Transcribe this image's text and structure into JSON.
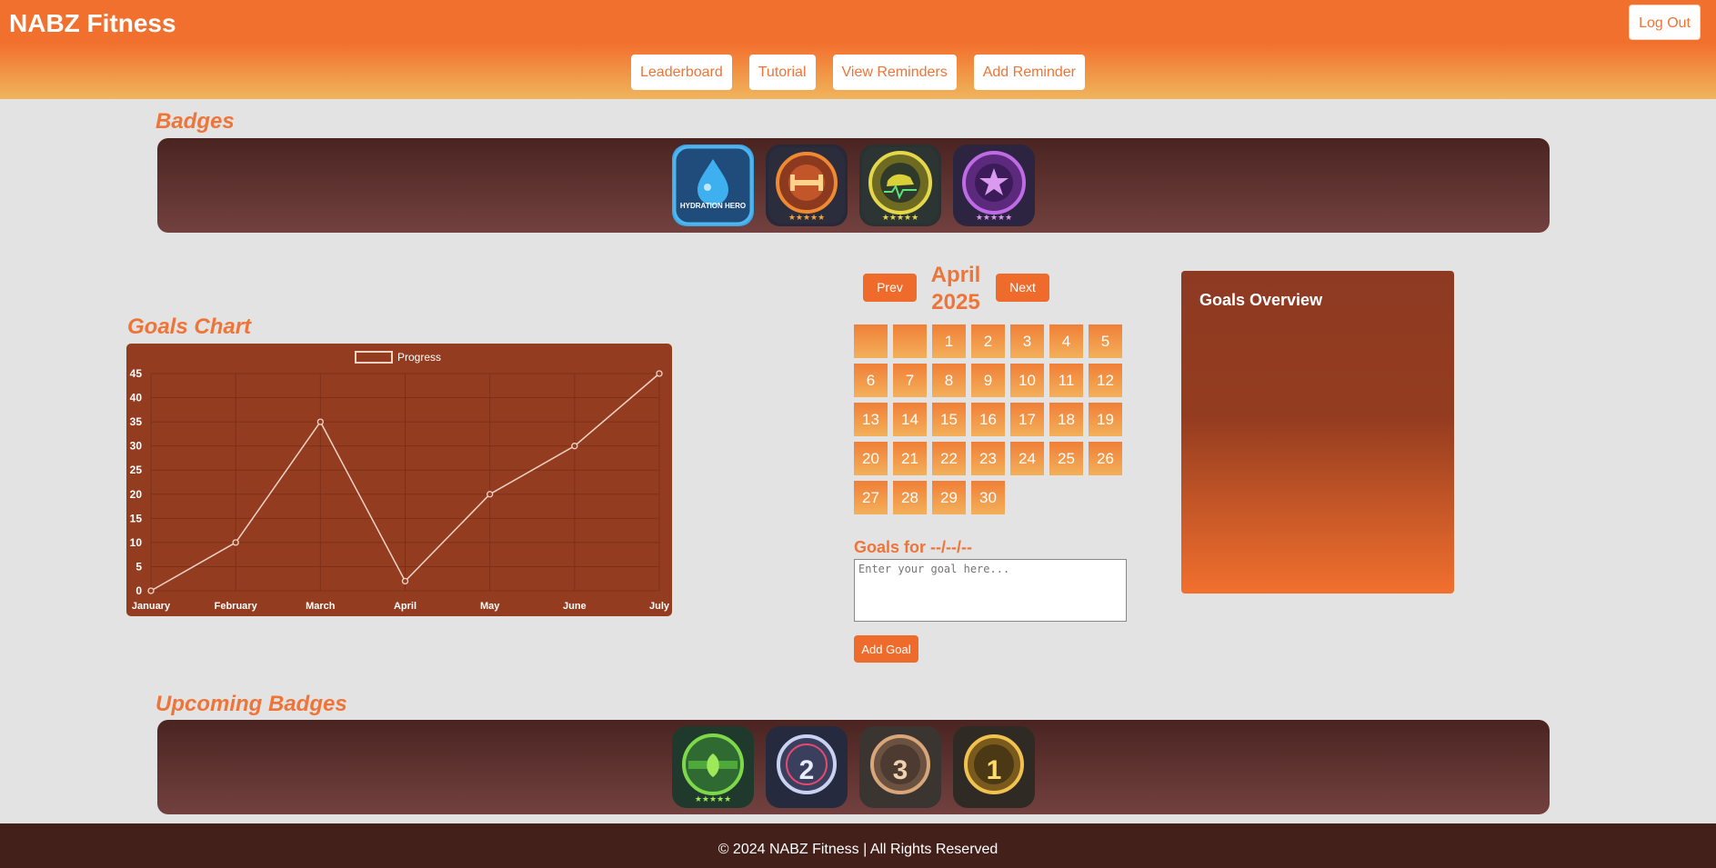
{
  "app": {
    "title": "NABZ Fitness",
    "logout_label": "Log Out"
  },
  "nav": [
    "Leaderboard",
    "Tutorial",
    "View Reminders",
    "Add Reminder"
  ],
  "badges": {
    "title": "Badges",
    "items": [
      {
        "icon": "hydration-hero-badge-icon",
        "caption": "HYDRATION HERO"
      },
      {
        "icon": "workout-champion-badge-icon",
        "caption": ""
      },
      {
        "icon": "step-badge-icon",
        "caption": ""
      },
      {
        "icon": "sleep-star-badge-icon",
        "caption": ""
      }
    ]
  },
  "upcoming_badges": {
    "title": "Upcoming Badges",
    "items": [
      {
        "icon": "nutrition-warrior-badge-icon",
        "caption": ""
      },
      {
        "icon": "top-2-badge-icon",
        "caption": "2"
      },
      {
        "icon": "top-3-badge-icon",
        "caption": "3"
      },
      {
        "icon": "top-1-badge-icon",
        "caption": "1"
      }
    ]
  },
  "goals_chart": {
    "title": "Goals Chart",
    "chart_data": {
      "type": "line",
      "categories": [
        "January",
        "February",
        "March",
        "April",
        "May",
        "June",
        "July"
      ],
      "series": [
        {
          "name": "Progress",
          "values": [
            0,
            10,
            35,
            2,
            20,
            30,
            45
          ]
        }
      ],
      "ylim": [
        0,
        45
      ],
      "yticks": [
        0,
        5,
        10,
        15,
        20,
        25,
        30,
        35,
        40,
        45
      ],
      "grid": true,
      "legend": "top-center",
      "colors": {
        "background": "#943c20",
        "line": "#f3d3c6",
        "grid": "#7c301a"
      }
    }
  },
  "calendar": {
    "month": "April",
    "year": "2025",
    "prev_label": "Prev",
    "next_label": "Next",
    "leading_blanks": 2,
    "days": [
      "1",
      "2",
      "3",
      "4",
      "5",
      "6",
      "7",
      "8",
      "9",
      "10",
      "11",
      "12",
      "13",
      "14",
      "15",
      "16",
      "17",
      "18",
      "19",
      "20",
      "21",
      "22",
      "23",
      "24",
      "25",
      "26",
      "27",
      "28",
      "29",
      "30"
    ]
  },
  "goal_form": {
    "goals_for_label": "Goals for --/--/--",
    "placeholder": "Enter your goal here...",
    "add_label": "Add Goal"
  },
  "overview": {
    "title": "Goals Overview"
  },
  "footer": {
    "text": "© 2024 NABZ Fitness | All Rights Reserved"
  },
  "colors": {
    "accent": "#ef7438",
    "header_top": "#f2702e",
    "header_bottom": "#f0b55c",
    "footer": "#43201a"
  }
}
